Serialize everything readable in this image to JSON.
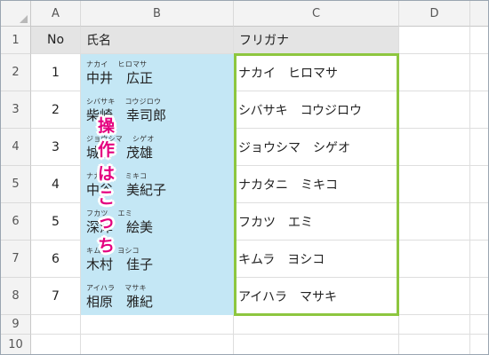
{
  "columns": [
    "A",
    "B",
    "C",
    "D"
  ],
  "rows": [
    "1",
    "2",
    "3",
    "4",
    "5",
    "6",
    "7",
    "8",
    "9",
    "10"
  ],
  "header": {
    "no": "No",
    "name": "氏名",
    "furigana": "フリガナ"
  },
  "records": [
    {
      "no": "1",
      "ruby": "ナカイ　 ヒロマサ",
      "name": "中井　広正",
      "kana": "ナカイ　ヒロマサ"
    },
    {
      "no": "2",
      "ruby": "シバサキ　 コウジロウ",
      "name": "柴崎　幸司郎",
      "kana": "シバサキ　コウジロウ"
    },
    {
      "no": "3",
      "ruby": "ジョウシマ　 シゲオ",
      "name": "城島　茂雄",
      "kana": "ジョウシマ　シゲオ"
    },
    {
      "no": "4",
      "ruby": "ナカタニ　 ミキコ",
      "name": "中谷　美紀子",
      "kana": "ナカタニ　ミキコ"
    },
    {
      "no": "5",
      "ruby": "フカツ　 エミ",
      "name": "深津　絵美",
      "kana": "フカツ　エミ"
    },
    {
      "no": "6",
      "ruby": "キムラ　 ヨシコ",
      "name": "木村　佳子",
      "kana": "キムラ　ヨシコ"
    },
    {
      "no": "7",
      "ruby": "アイハラ　 マサキ",
      "name": "相原　雅紀",
      "kana": "アイハラ　マサキ"
    }
  ],
  "callout": "操作はこっち",
  "colors": {
    "name_fill": "#c4e7f5",
    "selection_border": "#8dc63f",
    "callout_text": "#e4007f",
    "header_fill": "#e4e4e4"
  }
}
